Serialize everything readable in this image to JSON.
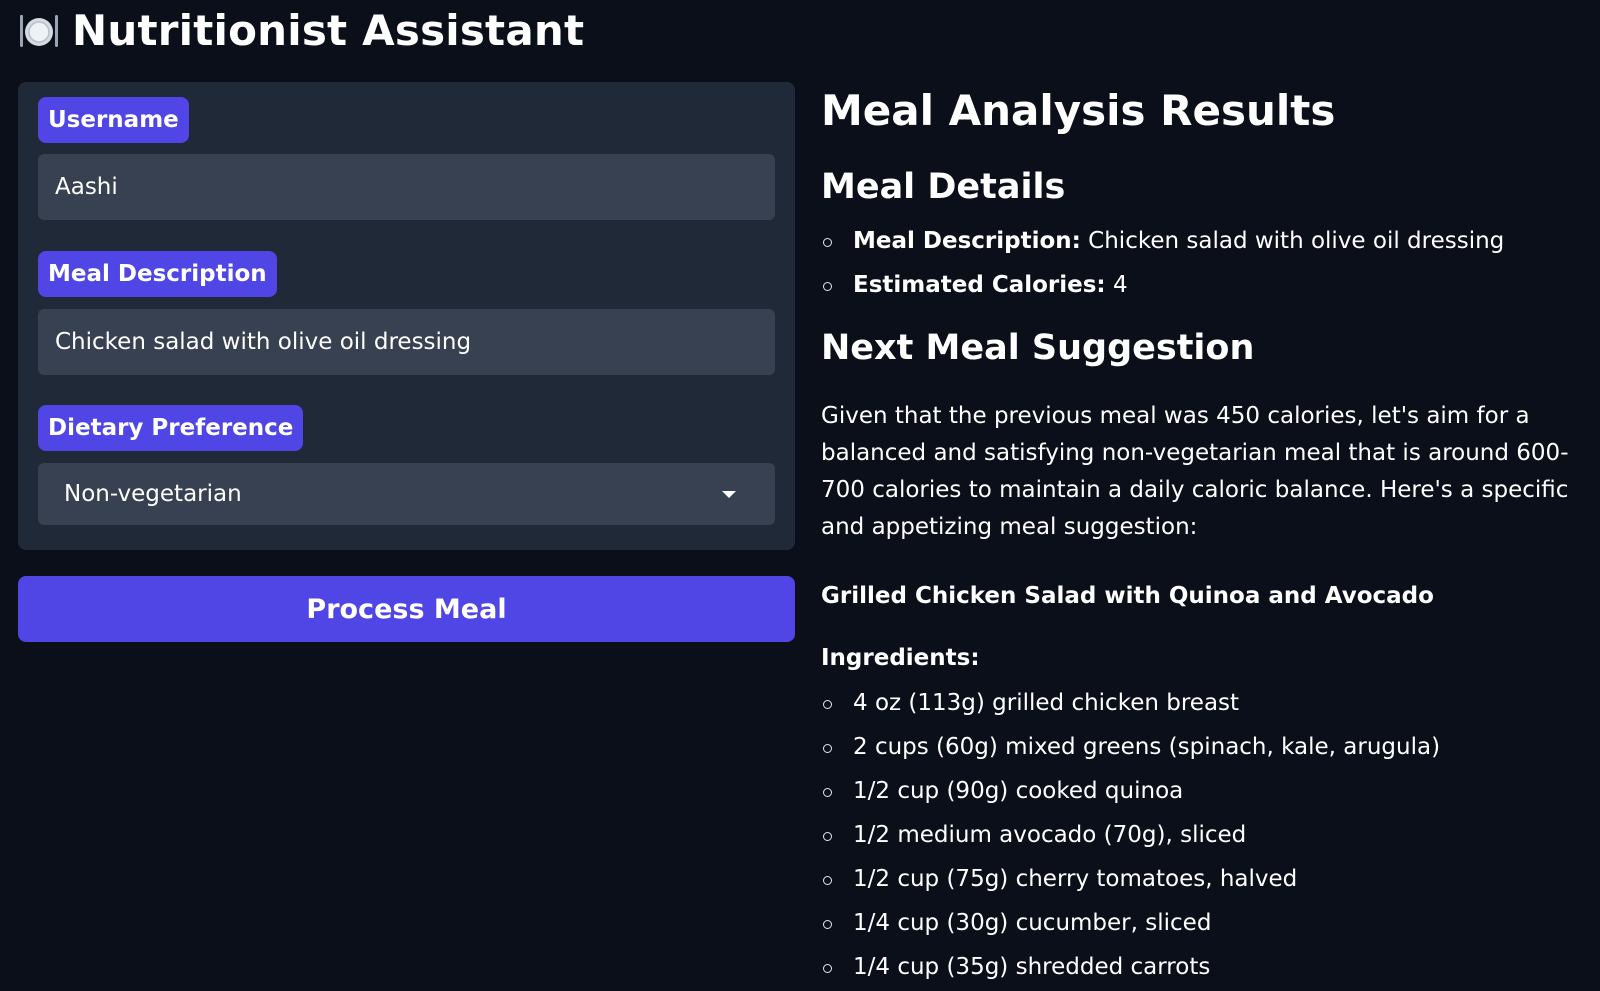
{
  "app": {
    "title": "Nutritionist Assistant",
    "title_icon": "plate-with-cutlery-icon"
  },
  "form": {
    "username": {
      "label": "Username",
      "value": "Aashi"
    },
    "meal_description": {
      "label": "Meal Description",
      "value": "Chicken salad with olive oil dressing"
    },
    "dietary_preference": {
      "label": "Dietary Preference",
      "selected": "Non-vegetarian"
    },
    "process_button": "Process Meal"
  },
  "results": {
    "title": "Meal Analysis Results",
    "meal_details": {
      "heading": "Meal Details",
      "items": [
        {
          "label": "Meal Description:",
          "value": "Chicken salad with olive oil dressing"
        },
        {
          "label": "Estimated Calories:",
          "value": "4"
        }
      ]
    },
    "next_meal": {
      "heading": "Next Meal Suggestion",
      "paragraph": "Given that the previous meal was 450 calories, let's aim for a balanced and satisfying non-vegetarian meal that is around 600-700 calories to maintain a daily caloric balance. Here's a specific and appetizing meal suggestion:",
      "meal_name": "Grilled Chicken Salad with Quinoa and Avocado",
      "ingredients_heading": "Ingredients:",
      "ingredients": [
        "4 oz (113g) grilled chicken breast",
        "2 cups (60g) mixed greens (spinach, kale, arugula)",
        "1/2 cup (90g) cooked quinoa",
        "1/2 medium avocado (70g), sliced",
        "1/2 cup (75g) cherry tomatoes, halved",
        "1/4 cup (30g) cucumber, sliced",
        "1/4 cup (35g) shredded carrots"
      ]
    }
  },
  "colors": {
    "background": "#0b0f19",
    "panel": "#1f2937",
    "input": "#374151",
    "accent": "#4f46e5"
  }
}
